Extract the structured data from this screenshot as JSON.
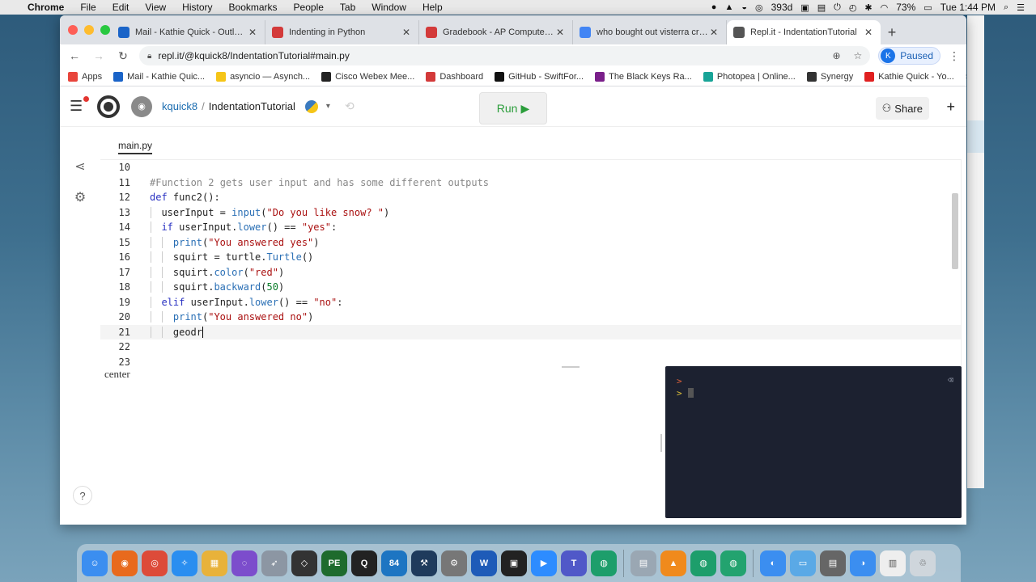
{
  "menubar": {
    "app": "Chrome",
    "items": [
      "File",
      "Edit",
      "View",
      "History",
      "Bookmarks",
      "People",
      "Tab",
      "Window",
      "Help"
    ],
    "status_badge": "393d",
    "battery": "73%",
    "clock": "Tue 1:44 PM"
  },
  "tabs": [
    {
      "label": "Mail - Kathie Quick - Outlook",
      "favicon_color": "#1a64c8",
      "active": false
    },
    {
      "label": "Indenting in Python",
      "favicon_color": "#d33a3a",
      "active": false
    },
    {
      "label": "Gradebook - AP Computer Scie...",
      "favicon_color": "#d33a3a",
      "active": false
    },
    {
      "label": "who bought out visterra credit...",
      "favicon_color": "#4285f4",
      "active": false
    },
    {
      "label": "Repl.it - IndentationTutorial",
      "favicon_color": "#555555",
      "active": true
    }
  ],
  "toolbar": {
    "url": "repl.it/@kquick8/IndentationTutorial#main.py",
    "profile_initial": "K",
    "profile_status": "Paused"
  },
  "bookmarks": [
    {
      "label": "Apps",
      "color": "#e8453c"
    },
    {
      "label": "Mail - Kathie Quic...",
      "color": "#1a64c8"
    },
    {
      "label": "asyncio — Asynch...",
      "color": "#f5c518"
    },
    {
      "label": "Cisco Webex Mee...",
      "color": "#222222"
    },
    {
      "label": "Dashboard",
      "color": "#d33a3a"
    },
    {
      "label": "GitHub - SwiftFor...",
      "color": "#111111"
    },
    {
      "label": "The Black Keys Ra...",
      "color": "#7a1f8a"
    },
    {
      "label": "Photopea | Online...",
      "color": "#18a497"
    },
    {
      "label": "Synergy",
      "color": "#333333"
    },
    {
      "label": "Kathie Quick - Yo...",
      "color": "#e02020"
    }
  ],
  "repl": {
    "user": "kquick8",
    "separator": "/",
    "project": "IndentationTutorial",
    "run_label": "Run",
    "share_label": "Share",
    "file_tab": "main.py",
    "turtle_label": "center"
  },
  "code_lines": [
    {
      "n": "10",
      "indent": 0,
      "html": ""
    },
    {
      "n": "11",
      "indent": 0,
      "html": "<span class=\"tok-com\">#Function 2 gets user input and has some different outputs</span>"
    },
    {
      "n": "12",
      "indent": 0,
      "html": "<span class=\"tok-kw\">def</span> func2():"
    },
    {
      "n": "13",
      "indent": 1,
      "html": "userInput = <span class=\"tok-fn\">input</span>(<span class=\"tok-str\">\"Do you like snow? \"</span>)"
    },
    {
      "n": "14",
      "indent": 1,
      "html": "<span class=\"tok-kw\">if</span> userInput.<span class=\"tok-fn\">lower</span>() == <span class=\"tok-str\">\"yes\"</span>:"
    },
    {
      "n": "15",
      "indent": 2,
      "html": "<span class=\"tok-fn\">print</span>(<span class=\"tok-str\">\"You answered yes\"</span>)"
    },
    {
      "n": "16",
      "indent": 2,
      "html": "squirt = turtle.<span class=\"tok-fn\">Turtle</span>()"
    },
    {
      "n": "17",
      "indent": 2,
      "html": "squirt.<span class=\"tok-fn\">color</span>(<span class=\"tok-str\">\"red\"</span>)"
    },
    {
      "n": "18",
      "indent": 2,
      "html": "squirt.<span class=\"tok-fn\">backward</span>(<span class=\"tok-num\">50</span>)"
    },
    {
      "n": "19",
      "indent": 1,
      "html": "<span class=\"tok-kw\">elif</span> userInput.<span class=\"tok-fn\">lower</span>() == <span class=\"tok-str\">\"no\"</span>:"
    },
    {
      "n": "20",
      "indent": 2,
      "html": "<span class=\"tok-fn\">print</span>(<span class=\"tok-str\">\"You answered no\"</span>)"
    },
    {
      "n": "21",
      "indent": 2,
      "html": "geodr<span class=\"caret\"></span>",
      "current": true
    },
    {
      "n": "22",
      "indent": 0,
      "html": ""
    },
    {
      "n": "23",
      "indent": 0,
      "html": ""
    }
  ],
  "console": {
    "prompt1": ">",
    "prompt2": ">"
  },
  "colors": {
    "run_green": "#2a9d3a",
    "console_bg": "#1c2130",
    "link_blue": "#1a6cb0"
  }
}
